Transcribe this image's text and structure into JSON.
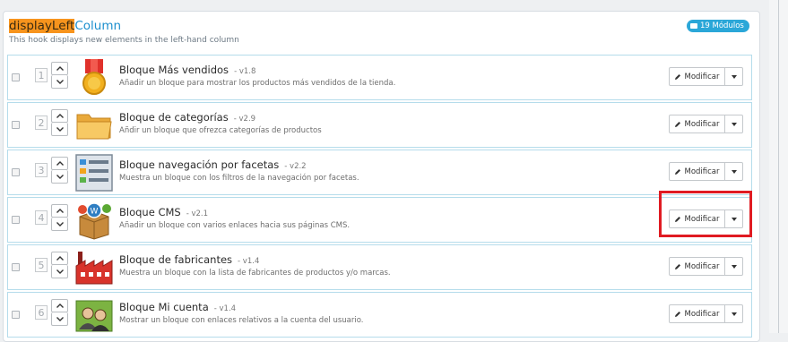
{
  "hook": {
    "title_highlighted": "displayLeft",
    "title_rest": "Column",
    "description": "This hook displays new elements in the left-hand column",
    "module_count_badge": "19 Módulos"
  },
  "actions": {
    "modify_label": "Modificar"
  },
  "modules": [
    {
      "position": "1",
      "name": "Bloque Más vendidos",
      "version": "- v1.8",
      "description": "Añadir un bloque para mostrar los productos más vendidos de la tienda.",
      "icon": "medal-icon"
    },
    {
      "position": "2",
      "name": "Bloque de categorías",
      "version": "- v2.9",
      "description": "Añdir un bloque que ofrezca categorías de productos",
      "icon": "folder-icon"
    },
    {
      "position": "3",
      "name": "Bloque navegación por facetas",
      "version": "- v2.2",
      "description": "Muestra un bloque con los filtros de la navegación por facetas.",
      "icon": "filter-list-icon"
    },
    {
      "position": "4",
      "name": "Bloque CMS",
      "version": "- v2.1",
      "description": "Añadir un bloque con varios enlaces hacia sus páginas CMS.",
      "icon": "cms-box-icon"
    },
    {
      "position": "5",
      "name": "Bloque de fabricantes",
      "version": "- v1.4",
      "description": "Muestra un bloque con la lista de fabricantes de productos y/o marcas.",
      "icon": "factory-icon"
    },
    {
      "position": "6",
      "name": "Bloque Mi cuenta",
      "version": "- v1.4",
      "description": "Mostrar un bloque con enlaces relativos a la cuenta del usuario.",
      "icon": "account-users-icon"
    }
  ]
}
